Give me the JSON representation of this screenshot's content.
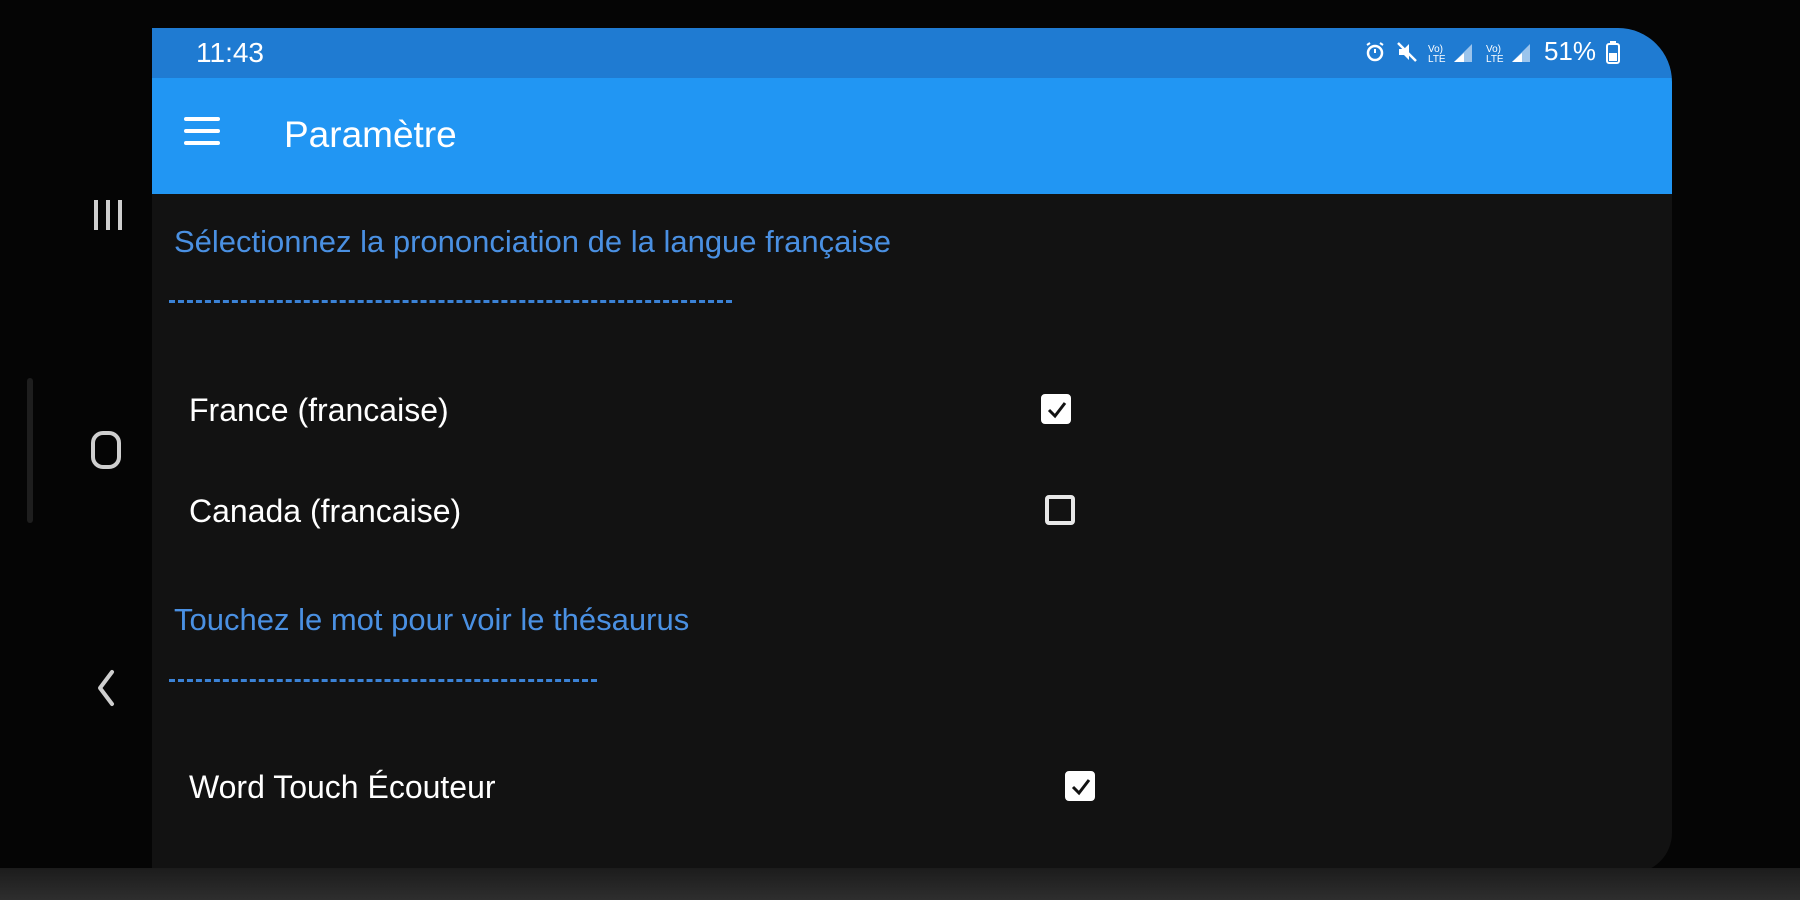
{
  "status_bar": {
    "time": "11:43",
    "battery": "51%",
    "icons": [
      "alarm-icon",
      "mute-icon",
      "signal-icon",
      "signal-icon",
      "battery-icon"
    ]
  },
  "app_bar": {
    "menu_icon": "menu-icon",
    "title": "Paramètre"
  },
  "sections": [
    {
      "heading": "Sélectionnez la prononciation de la langue française",
      "options": [
        {
          "label": "France (francaise)",
          "checked": true
        },
        {
          "label": "Canada (francaise)",
          "checked": false
        }
      ]
    },
    {
      "heading": "Touchez le mot pour voir le thésaurus",
      "options": [
        {
          "label": "Word Touch Écouteur",
          "checked": true
        }
      ]
    }
  ],
  "nav": {
    "recents_icon": "recents-icon",
    "home_icon": "home-icon",
    "back_icon": "back-icon"
  },
  "colors": {
    "status_bar": "#1f7bd2",
    "app_bar": "#2196f3",
    "heading": "#4a90e2",
    "background": "#121212"
  }
}
